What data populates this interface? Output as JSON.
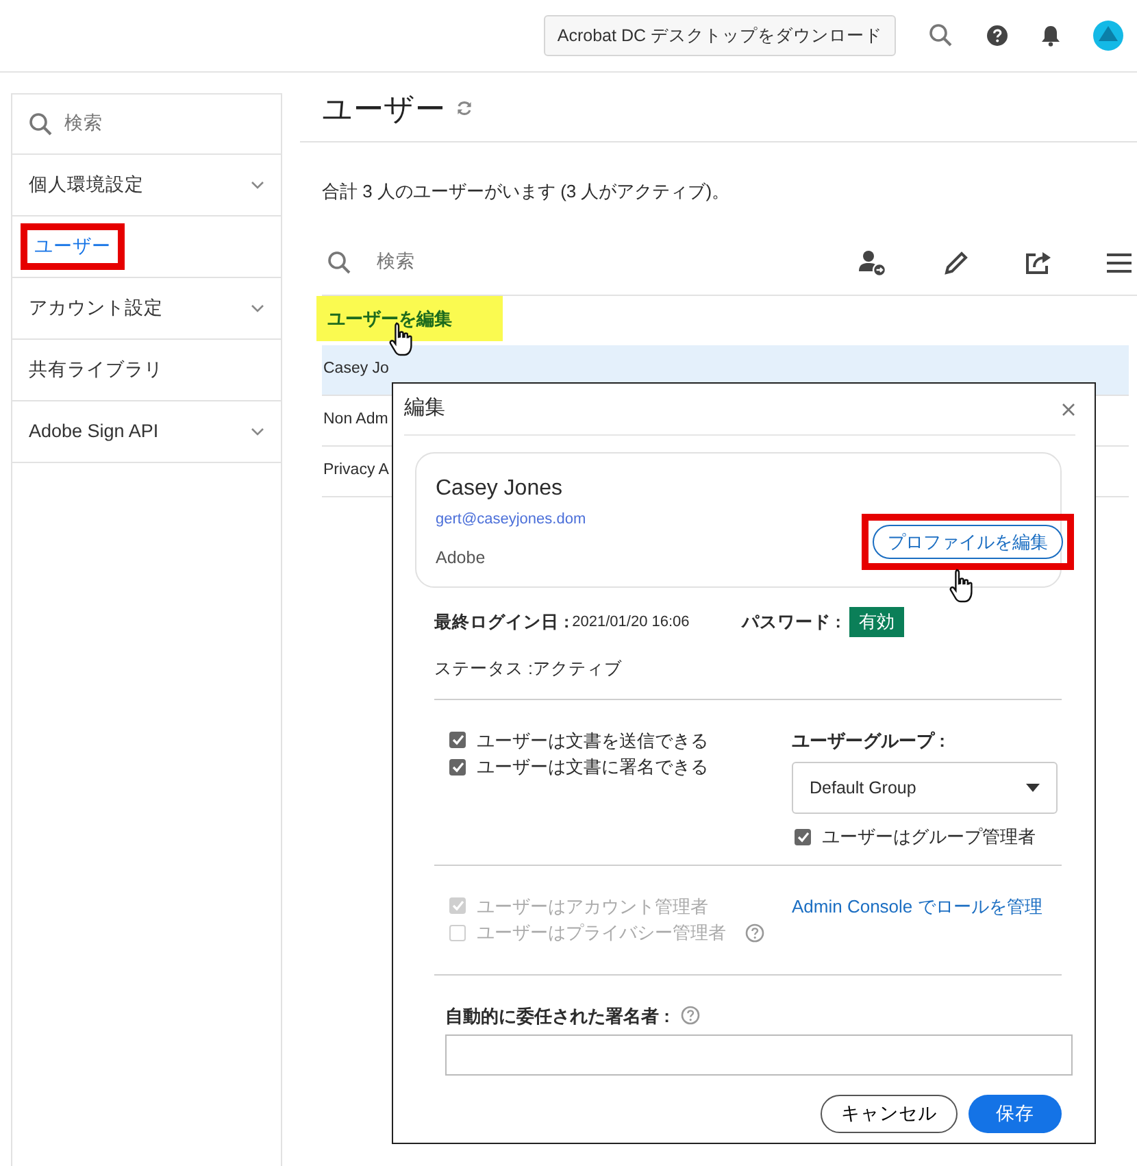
{
  "header": {
    "download_button": "Acrobat DC デスクトップをダウンロード"
  },
  "sidebar": {
    "search_placeholder": "検索",
    "items": [
      {
        "label": "個人環境設定",
        "expandable": true,
        "selected": false
      },
      {
        "label": "ユーザー",
        "expandable": false,
        "selected": true
      },
      {
        "label": "アカウント設定",
        "expandable": true,
        "selected": false
      },
      {
        "label": "共有ライブラリ",
        "expandable": false,
        "selected": false
      },
      {
        "label": "Adobe Sign API",
        "expandable": true,
        "selected": false
      }
    ]
  },
  "page": {
    "title": "ユーザー",
    "summary": "合計 3 人のユーザーがいます (3 人がアクティブ)。",
    "search_placeholder": "検索",
    "tooltip": "ユーザーを編集",
    "rows": [
      {
        "name": "Casey Jo",
        "selected": true
      },
      {
        "name": "Non Adm",
        "selected": false
      },
      {
        "name": "Privacy A",
        "selected": false
      }
    ]
  },
  "dialog": {
    "title": "編集",
    "profile": {
      "name": "Casey Jones",
      "email": "gert@caseyjones.dom",
      "org": "Adobe",
      "edit_button": "プロファイルを編集"
    },
    "last_login_label": "最終ログイン日 :",
    "last_login": "2021/01/20 16:06",
    "password_label": "パスワード :",
    "password_status": "有効",
    "status_label": "ステータス :",
    "status": "アクティブ",
    "permissions": [
      {
        "label": "ユーザーは文書を送信できる",
        "checked": true,
        "disabled": false
      },
      {
        "label": "ユーザーは文書に署名できる",
        "checked": true,
        "disabled": false
      }
    ],
    "group_label": "ユーザーグループ :",
    "group_value": "Default Group",
    "group_admin": {
      "label": "ユーザーはグループ管理者",
      "checked": true,
      "disabled": false
    },
    "roles": [
      {
        "label": "ユーザーはアカウント管理者",
        "checked": true,
        "disabled": true,
        "help": false
      },
      {
        "label": "ユーザーはプライバシー管理者",
        "checked": false,
        "disabled": true,
        "help": true
      }
    ],
    "roles_link": "Admin Console でロールを管理",
    "delegate_label": "自動的に委任された署名者 :",
    "cancel_button": "キャンセル",
    "save_button": "保存"
  }
}
